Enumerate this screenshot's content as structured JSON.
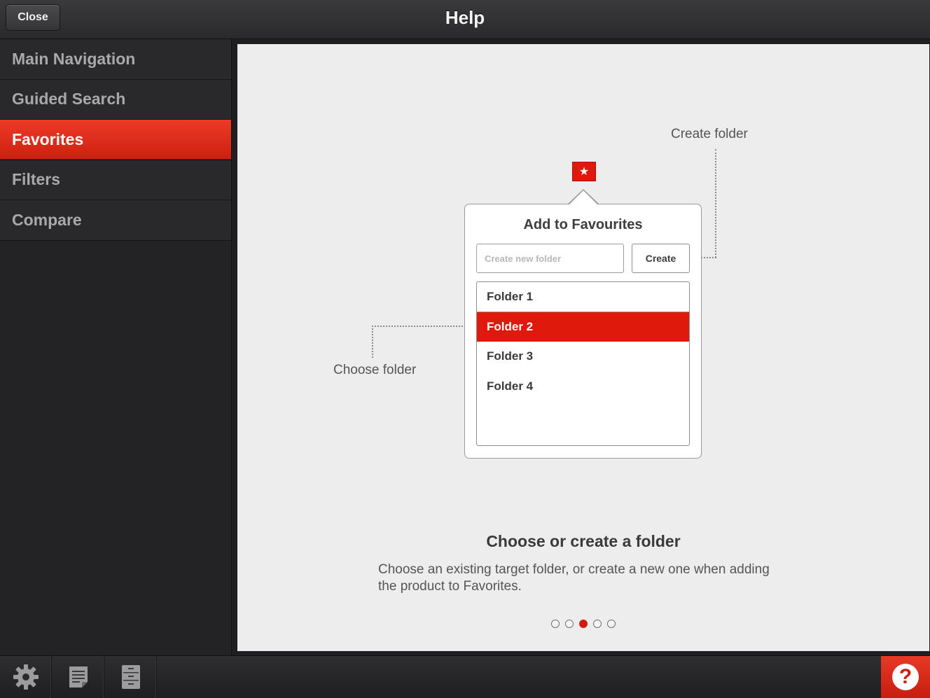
{
  "window": {
    "title": "Help",
    "close_label": "Close"
  },
  "sidebar": {
    "items": [
      {
        "label": "Main Navigation",
        "active": false
      },
      {
        "label": "Guided Search",
        "active": false
      },
      {
        "label": "Favorites",
        "active": true
      },
      {
        "label": "Filters",
        "active": false
      },
      {
        "label": "Compare",
        "active": false
      }
    ]
  },
  "illustration": {
    "popover_title": "Add to Favourites",
    "input_placeholder": "Create new folder",
    "create_label": "Create",
    "folders": [
      "Folder 1",
      "Folder 2",
      "Folder 3",
      "Folder 4"
    ],
    "selected_folder": "Folder 2",
    "callout_create": "Create folder",
    "callout_choose": "Choose folder",
    "star_icon": "star-icon"
  },
  "caption": {
    "title": "Choose or create a folder",
    "body": "Choose an existing target folder, or create a new one when adding the product to Favorites."
  },
  "pager": {
    "total": 5,
    "current": 3
  },
  "bottombar": {
    "icons": [
      "gear-icon",
      "notes-icon",
      "cabinet-icon"
    ],
    "help_glyph": "?"
  },
  "colors": {
    "accent": "#e0190d",
    "sidebar_bg": "#232325",
    "panel_bg": "#ededed"
  }
}
